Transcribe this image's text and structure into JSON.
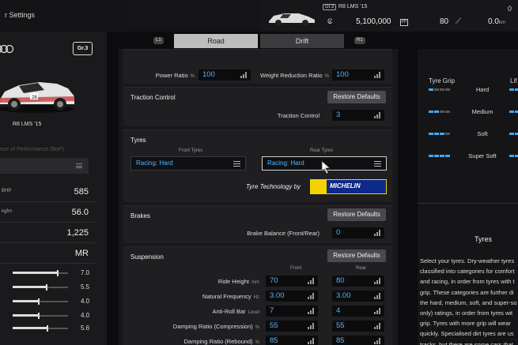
{
  "header": {
    "title": "r Settings",
    "car_badge": "Gr.3",
    "car_name": "R8 LMS '15",
    "credits": "5,100,000",
    "pp_value": "80",
    "mileage": "0.0",
    "mileage_unit": "km",
    "mileage_top": "0"
  },
  "tabs": {
    "left_hint": "L1",
    "road_label": "Road",
    "drift_label": "Drift",
    "right_hint": "R1"
  },
  "left_panel": {
    "class_badge": "Gr.3",
    "car_name": "R8 LMS '15",
    "bop_label": "nce of Performance (BoP)",
    "stats": [
      {
        "unit": "BHP",
        "value": "585"
      },
      {
        "unit": "kgfm",
        "value": "56.0"
      },
      {
        "unit": "",
        "value": "1,225"
      },
      {
        "unit": "",
        "value": "MR"
      }
    ],
    "sliders": [
      {
        "value": "7.0",
        "level": 0.8
      },
      {
        "value": "5.5",
        "level": 0.6
      },
      {
        "value": "4.0",
        "level": 0.45
      },
      {
        "value": "4.0",
        "level": 0.45
      },
      {
        "value": "5.6",
        "level": 0.62
      }
    ]
  },
  "sections": {
    "power": {
      "power_ratio_label": "Power Ratio",
      "power_ratio_unit": "%",
      "power_ratio_value": "100",
      "weight_ratio_label": "Weight Reduction Ratio",
      "weight_ratio_unit": "%",
      "weight_ratio_value": "100"
    },
    "traction": {
      "title": "Traction Control",
      "restore": "Restore Defaults",
      "label": "Traction Control",
      "value": "3"
    },
    "tyres": {
      "title": "Tyres",
      "front_header": "Front Tyres",
      "rear_header": "Rear Tyres",
      "front_value": "Racing: Hard",
      "rear_value": "Racing: Hard",
      "tech_label": "Tyre Technology by",
      "brand": "MICHELIN"
    },
    "brakes": {
      "title": "Brakes",
      "restore": "Restore Defaults",
      "label": "Brake Balance (Front/Rear)",
      "value": "0"
    },
    "suspension": {
      "title": "Suspension",
      "restore": "Restore Defaults",
      "front_header": "Front",
      "rear_header": "Rear",
      "rows": [
        {
          "label": "Ride Height",
          "unit": "mm",
          "front": "70",
          "rear": "80"
        },
        {
          "label": "Natural Frequency",
          "unit": "Hz",
          "front": "3.00",
          "rear": "3.00"
        },
        {
          "label": "Anti-Roll Bar",
          "unit": "Level",
          "front": "7",
          "rear": "4"
        },
        {
          "label": "Damping Ratio (Compression)",
          "unit": "%",
          "front": "55",
          "rear": "55"
        },
        {
          "label": "Damping Ratio (Rebound)",
          "unit": "%",
          "front": "85",
          "rear": "85"
        }
      ]
    }
  },
  "right_panel": {
    "grip_header": "Tyre Grip",
    "life_header": "Lif",
    "rows": [
      {
        "label": "Hard",
        "grip": 1
      },
      {
        "label": "Medium",
        "grip": 2
      },
      {
        "label": "Soft",
        "grip": 3
      },
      {
        "label": "Super Soft",
        "grip": 4
      }
    ],
    "title": "Tyres",
    "description": "Select your tyres. Dry-weather tyres\nclassified into categories for comfort\nand racing, in order from tyres with t\ngrip. These categories are further di\nthe hard, medium, soft, and super-so\nonly) ratings, in order from tyres wit\ngrip. Tyres with more grip will wear \nquickly. Specialised dirt tyres are us\ntracks, but there are some cars that\nequip these tyres.",
    "colors": {
      "active": "#48a6ee",
      "inactive": "#555555"
    }
  }
}
